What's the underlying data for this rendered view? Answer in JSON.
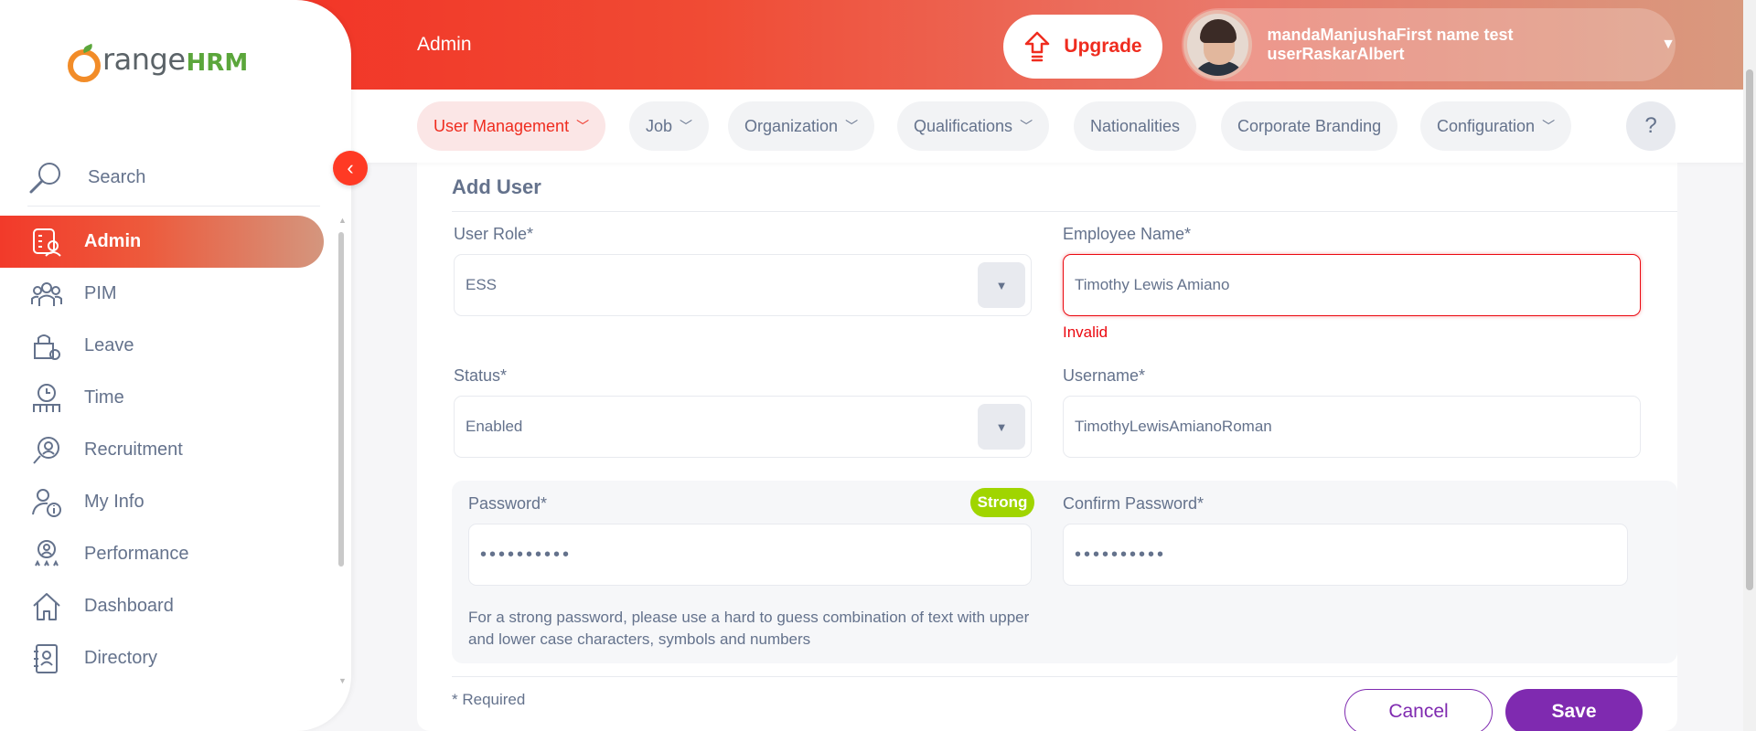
{
  "brand": {
    "logo_main": "range",
    "logo_accent": "HRM"
  },
  "topbar": {
    "title": "Admin",
    "upgrade_label": "Upgrade",
    "user_name": "mandaManjushaFirst name test userRaskarAlbert"
  },
  "sidebar": {
    "search_label": "Search",
    "items": [
      {
        "label": "Admin",
        "icon": "admin-icon",
        "active": true
      },
      {
        "label": "PIM",
        "icon": "pim-icon"
      },
      {
        "label": "Leave",
        "icon": "leave-icon"
      },
      {
        "label": "Time",
        "icon": "time-icon"
      },
      {
        "label": "Recruitment",
        "icon": "recruitment-icon"
      },
      {
        "label": "My Info",
        "icon": "my-info-icon"
      },
      {
        "label": "Performance",
        "icon": "performance-icon"
      },
      {
        "label": "Dashboard",
        "icon": "dashboard-icon"
      },
      {
        "label": "Directory",
        "icon": "directory-icon"
      }
    ]
  },
  "subnav": {
    "tabs": [
      {
        "label": "User Management",
        "active": true
      },
      {
        "label": "Job"
      },
      {
        "label": "Organization"
      },
      {
        "label": "Qualifications"
      },
      {
        "label": "Nationalities"
      },
      {
        "label": "Corporate Branding"
      },
      {
        "label": "Configuration"
      }
    ],
    "help_label": "?"
  },
  "form": {
    "title": "Add User",
    "user_role": {
      "label": "User Role*",
      "value": "ESS"
    },
    "employee_name": {
      "label": "Employee Name*",
      "value": "Timothy Lewis Amiano",
      "error": "Invalid"
    },
    "status": {
      "label": "Status*",
      "value": "Enabled"
    },
    "username": {
      "label": "Username*",
      "value": "TimothyLewisAmianoRoman"
    },
    "password": {
      "label": "Password*",
      "value": "••••••••••",
      "strength": "Strong"
    },
    "confirm_password": {
      "label": "Confirm Password*",
      "value": "••••••••••"
    },
    "hint": "For a strong password, please use a hard to guess combination of text with upper and lower case characters, symbols and numbers",
    "required_note": "* Required",
    "cancel_label": "Cancel",
    "save_label": "Save"
  },
  "colors": {
    "accent": "#ef2c1f",
    "primary_button": "#7f2ab0",
    "strength_badge": "#a0d500",
    "error": "#eb0910"
  }
}
